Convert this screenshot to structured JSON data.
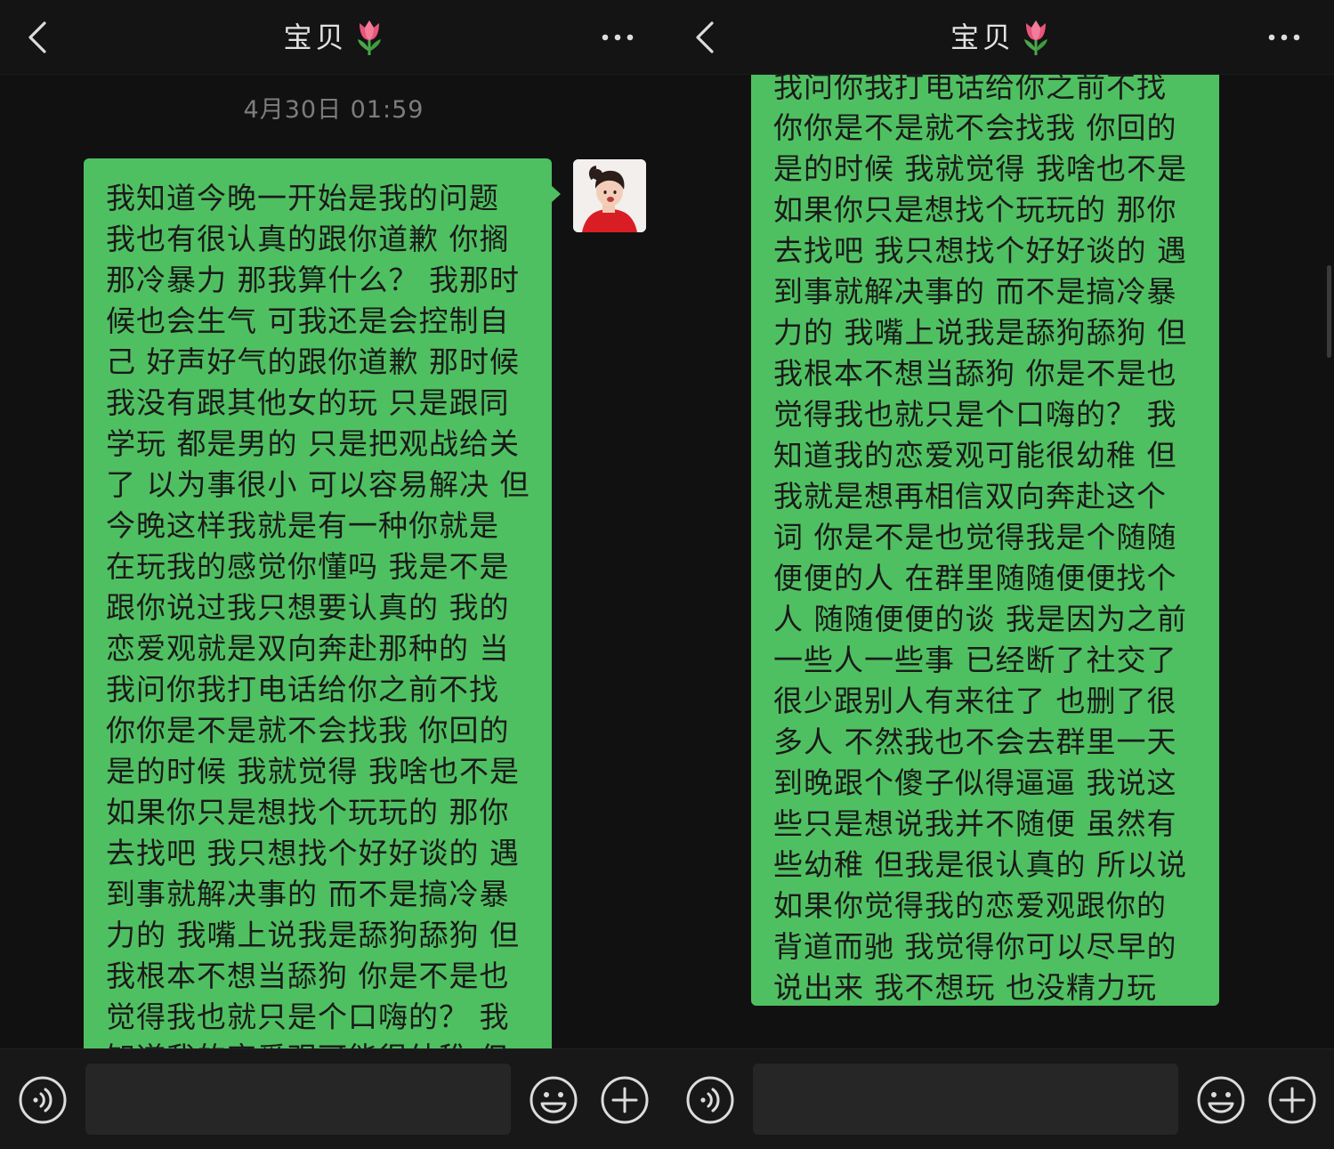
{
  "panels": [
    {
      "header": {
        "title": "宝贝"
      },
      "timestamp": "4月30日 01:59",
      "message_lines": [
        "我知道今晚一开始是我的问题",
        "我也有很认真的跟你道歉 你搁",
        "那冷暴力 那我算什么？ 我那时",
        "候也会生气 可我还是会控制自",
        "己 好声好气的跟你道歉 那时候",
        "我没有跟其他女的玩 只是跟同",
        "学玩 都是男的 只是把观战给关",
        "了 以为事很小 可以容易解决 但",
        "今晚这样我就是有一种你就是",
        "在玩我的感觉你懂吗 我是不是",
        "跟你说过我只想要认真的 我的",
        "恋爱观就是双向奔赴那种的 当",
        "我问你我打电话给你之前不找",
        "你你是不是就不会找我 你回的",
        "是的时候 我就觉得 我啥也不是",
        "如果你只是想找个玩玩的 那你",
        "去找吧 我只想找个好好谈的 遇",
        "到事就解决事的 而不是搞冷暴",
        "力的 我嘴上说我是舔狗舔狗 但",
        "我根本不想当舔狗 你是不是也",
        "觉得我也就只是个口嗨的？ 我",
        "知道我的恋爱观可能很幼稚 但"
      ]
    },
    {
      "header": {
        "title": "宝贝"
      },
      "message_lines": [
        "我问你我打电话给你之前不找",
        "你你是不是就不会找我 你回的",
        "是的时候 我就觉得 我啥也不是",
        "如果你只是想找个玩玩的 那你",
        "去找吧 我只想找个好好谈的 遇",
        "到事就解决事的 而不是搞冷暴",
        "力的 我嘴上说我是舔狗舔狗 但",
        "我根本不想当舔狗 你是不是也",
        "觉得我也就只是个口嗨的？ 我",
        "知道我的恋爱观可能很幼稚 但",
        "我就是想再相信双向奔赴这个",
        "词 你是不是也觉得我是个随随",
        "便便的人  在群里随随便便找个",
        "人 随随便便的谈 我是因为之前",
        "一些人一些事 已经断了社交了",
        "很少跟别人有来往了 也删了很",
        "多人  不然我也不会去群里一天",
        "到晚跟个傻子似得逼逼 我说这",
        "些只是想说我并不随便 虽然有",
        "些幼稚 但我是很认真的 所以说",
        "如果你觉得我的恋爱观跟你的",
        "背道而驰 我觉得你可以尽早的",
        "说出来 我不想玩 也没精力玩"
      ]
    }
  ],
  "colors": {
    "background": "#111111",
    "bubble": "#4fc061",
    "header": "#141414",
    "icon": "#dcdcdc"
  },
  "icons": [
    "back-icon",
    "tulip-icon",
    "more-icon",
    "voice-icon",
    "emoji-icon",
    "plus-icon"
  ]
}
